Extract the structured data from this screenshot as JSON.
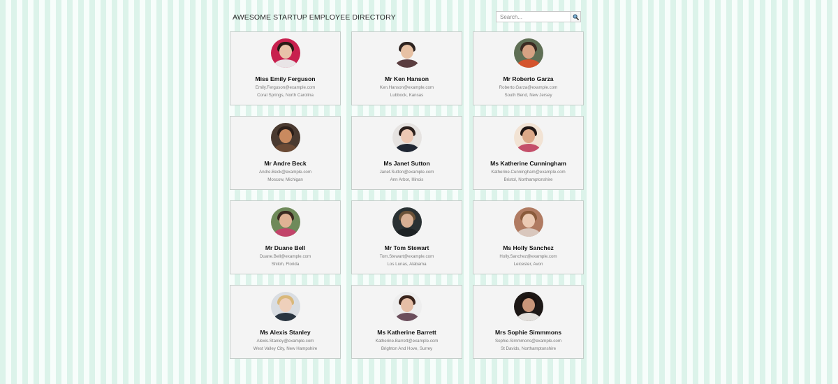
{
  "header": {
    "title": "AWESOME STARTUP EMPLOYEE DIRECTORY",
    "search_placeholder": "Search..."
  },
  "employees": [
    {
      "name": "Miss Emily Ferguson",
      "email": "Emily.Ferguson@example.com",
      "location": "Coral Springs, North Carolina",
      "avatar": {
        "bg": "#c8204e",
        "skin": "#e8c2a9",
        "hair": "#2a1a16",
        "shirt": "#e9e4e6"
      }
    },
    {
      "name": "Mr Ken Hanson",
      "email": "Ken.Hanson@example.com",
      "location": "Lubbock, Kansas",
      "avatar": {
        "bg": "#f4f4f4",
        "skin": "#e7c1a4",
        "hair": "#2d2320",
        "shirt": "#5a3d3f"
      }
    },
    {
      "name": "Mr Roberto Garza",
      "email": "Roberto.Garza@example.com",
      "location": "South Bend, New Jersey",
      "avatar": {
        "bg": "#5f6f55",
        "skin": "#d6a283",
        "hair": "#3b2b22",
        "shirt": "#d4542d"
      }
    },
    {
      "name": "Mr Andre Beck",
      "email": "Andre.Beck@example.com",
      "location": "Moscow, Michigan",
      "avatar": {
        "bg": "#4a3a30",
        "skin": "#c98a5f",
        "hair": "#2b1e18",
        "shirt": "#6b4a35"
      }
    },
    {
      "name": "Ms Janet Sutton",
      "email": "Janet.Sutton@example.com",
      "location": "Ann Arbor, Illinois",
      "avatar": {
        "bg": "#e6e3e1",
        "skin": "#ecc8b4",
        "hair": "#2a1f1c",
        "shirt": "#1f2633"
      }
    },
    {
      "name": "Ms Katherine Cunningham",
      "email": "Katherine.Cunningham@example.com",
      "location": "Bristol, Northamptonshire",
      "avatar": {
        "bg": "#f2e3d4",
        "skin": "#dca888",
        "hair": "#201614",
        "shirt": "#c44f6a"
      }
    },
    {
      "name": "Mr Duane Bell",
      "email": "Duane.Bell@example.com",
      "location": "Shiloh, Florida",
      "avatar": {
        "bg": "#6f8a5a",
        "skin": "#e0b294",
        "hair": "#3b2a20",
        "shirt": "#c2446a"
      }
    },
    {
      "name": "Mr Tom Stewart",
      "email": "Tom.Stewart@example.com",
      "location": "Los Lunas, Alabama",
      "avatar": {
        "bg": "#2a3133",
        "skin": "#d9b094",
        "hair": "#6b5238",
        "shirt": "#1d2224"
      }
    },
    {
      "name": "Ms Holly Sanchez",
      "email": "Holly.Sanchez@example.com",
      "location": "Leicester, Avon",
      "avatar": {
        "bg": "#b07b62",
        "skin": "#eccab4",
        "hair": "#8a5a3b",
        "shirt": "#d9c7bd"
      }
    },
    {
      "name": "Ms Alexis Stanley",
      "email": "Alexis.Stanley@example.com",
      "location": "West Valley City, New Hampshire",
      "avatar": {
        "bg": "#d9dde2",
        "skin": "#efd0bb",
        "hair": "#d9b87a",
        "shirt": "#2a3540"
      }
    },
    {
      "name": "Ms Katherine Barrett",
      "email": "Katherine.Barrett@example.com",
      "location": "Brighton And Hove, Surrey",
      "avatar": {
        "bg": "#eeeeee",
        "skin": "#e5bea6",
        "hair": "#3a241c",
        "shirt": "#6b4e5c"
      }
    },
    {
      "name": "Mrs Sophie Simmmons",
      "email": "Sophie.Simmmons@example.com",
      "location": "St Davids, Northamptonshire",
      "avatar": {
        "bg": "#1d1816",
        "skin": "#c9967a",
        "hair": "#1a1210",
        "shirt": "#e3e0dc"
      }
    }
  ]
}
